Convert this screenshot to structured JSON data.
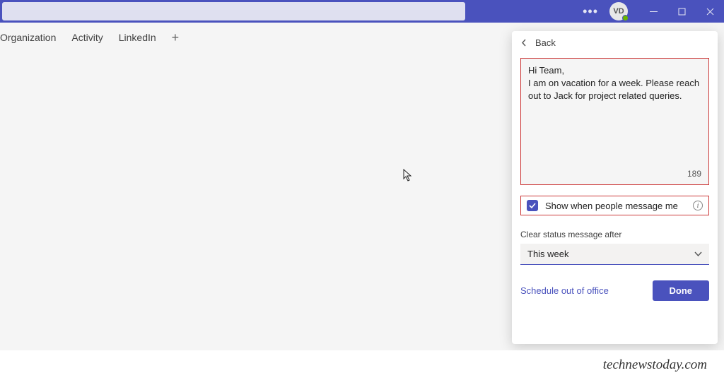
{
  "avatar_initials": "VD",
  "tabs": {
    "org": "Organization",
    "activity": "Activity",
    "linkedin": "LinkedIn"
  },
  "panel": {
    "back": "Back",
    "message_line1": "Hi Team,",
    "message_line2": "I am on vacation for a week. Please reach out to Jack for project related queries.",
    "char_count": "189",
    "checkbox_label": "Show when people message me",
    "clear_label": "Clear status message after",
    "dropdown_value": "This week",
    "schedule_link": "Schedule out of office",
    "done": "Done"
  },
  "watermark": "technewstoday.com"
}
